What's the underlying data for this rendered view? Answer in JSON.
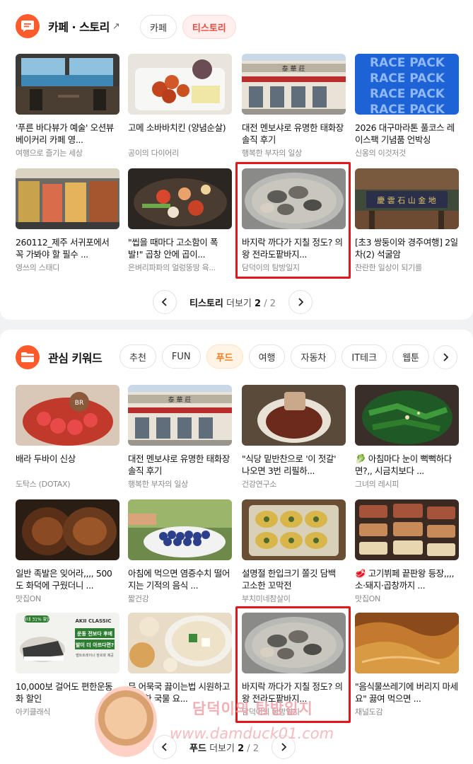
{
  "story": {
    "title": "카페 · 스토리",
    "title_mark": "↗",
    "chips": [
      "카페",
      "티스토리"
    ],
    "items": [
      {
        "title": "'푸른 바다뷰가 예술' 오션뷰 베이커리 카페 영...",
        "source": "여행으로 즐기는 세상"
      },
      {
        "title": "고메 소바바치킨 (양념순살)",
        "source": "공이의 다이어리"
      },
      {
        "title": "대전 멘보샤로 유명한 태화장 솔직 후기",
        "source": "행복한 부자의 일상"
      },
      {
        "title": "2026 대구마라톤 풀코스 레이스팩 기념품 언박싱",
        "source": "신옹의 이것저것"
      },
      {
        "title": "260112_제주 서귀포에서 꼭 가봐야 할 필수 ...",
        "source": "영쓰의 스태디"
      },
      {
        "title": "\"씹을 때마다 고소함이 폭발!\" 곱창 안에 곱이...",
        "source": "은벼리파파의 얼렁뚱땅 육..."
      },
      {
        "title": "바지락 까다가 지칠 정도? 의왕 전라도팥바지...",
        "source": "담덕이의 탐방일지"
      },
      {
        "title": "[초3 쌍둥이와 경주여행] 2일차(2) 석굴암",
        "source": "찬란한 일상이 되기를"
      }
    ],
    "pager": {
      "label": "티스토리",
      "more": "더보기",
      "page": "2",
      "sep": "/",
      "total": "2"
    }
  },
  "keywords": {
    "title": "관심 키워드",
    "chips": [
      "추천",
      "FUN",
      "푸드",
      "여행",
      "자동차",
      "IT테크",
      "웹툰"
    ],
    "items": [
      {
        "title": "배라 두바이 신상",
        "source": "도탁스 (DOTAX)"
      },
      {
        "title": "대전 멘보샤로 유명한 태화장 솔직 후기",
        "source": "행복한 부자의 일상"
      },
      {
        "title": "\"식당 밑반찬으로 '이 젓갈' 나오면 3번 리필하...",
        "source": "건강연구소"
      },
      {
        "title": "🥬 아침마다 눈이 뻑뻑하다면?,, 시금치보다 ...",
        "source": "그녀의 레시피"
      },
      {
        "title": "일반 족발은 잊어라,,,, 500도 화덕에 구웠더니 ...",
        "source": "맛집ON"
      },
      {
        "title": "아침에 먹으면 염증수치 떨어지는 기적의 음식 ...",
        "source": "짧건강"
      },
      {
        "title": "설명절 한입크기 쫄깃 담백 고소한 꼬막전",
        "source": "부치미네참살이"
      },
      {
        "title": "🥩 고기뷔페 끝판왕 등장,,,, 소·돼지·곱창까지 ...",
        "source": "맛집ON"
      },
      {
        "title": "10,000보 걸어도 편한운동화 할인",
        "source": "아키클래식"
      },
      {
        "title": "무 어묵국 끓이는법 시원하고 담백한 국물 요...",
        "source": "nj"
      },
      {
        "title": "바지락 까다가 지칠 정도? 의왕 전라도팥바지...",
        "source": "담덕이의 탐방일지"
      },
      {
        "title": "\"음식물쓰레기에 버리지 마세요\" 끓여 먹으면 ...",
        "source": "채널도감"
      }
    ],
    "ad": {
      "brand": "AKII CLASSIC",
      "badge": "최대 31% 할인",
      "line1": "운동 전보다 후에",
      "line2": "발이 더 아프다면?",
      "line3": "벨트트레이너 장르화 제공"
    },
    "pager": {
      "label": "푸드",
      "more": "더보기",
      "page": "2",
      "sep": "/",
      "total": "2"
    }
  },
  "thumb_labels": {
    "sign1": "泰 華 莊",
    "race": "RACE PACK",
    "temple": "慶 雲 石 山 金 地"
  },
  "watermark": {
    "text": "담덕이의 탐방일지",
    "url": "www.damduck01.com"
  },
  "colors": {
    "accent": "#ff5a2c",
    "highlight": "#e8141c",
    "chip_active": "#e84a3c"
  }
}
